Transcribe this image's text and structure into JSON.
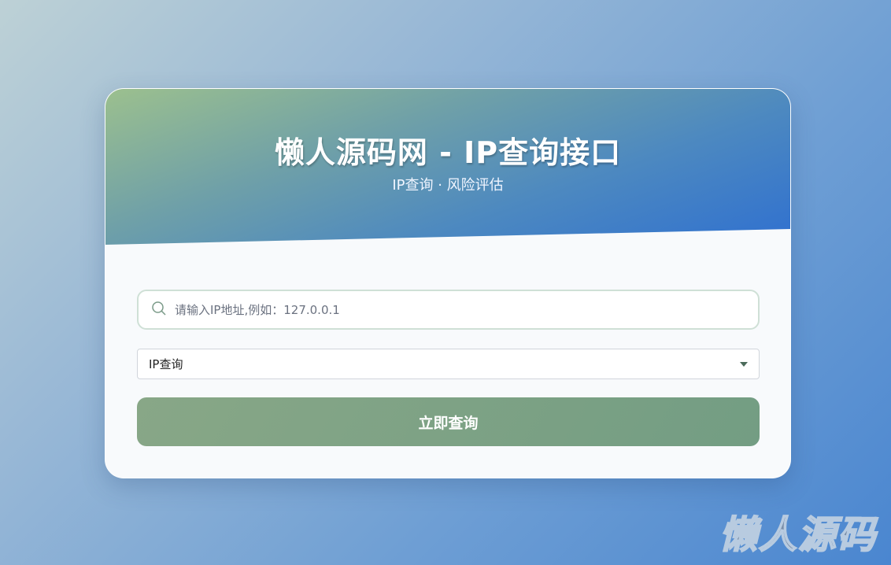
{
  "header": {
    "title": "懒人源码网 - IP查询接口",
    "subtitle": "IP查询 · 风险评估"
  },
  "search": {
    "placeholder": "请输入IP地址,例如：127.0.0.1",
    "icon": "search-icon"
  },
  "select": {
    "selected": "IP查询"
  },
  "submit_label": "立即查询",
  "watermark": "懒人源码"
}
